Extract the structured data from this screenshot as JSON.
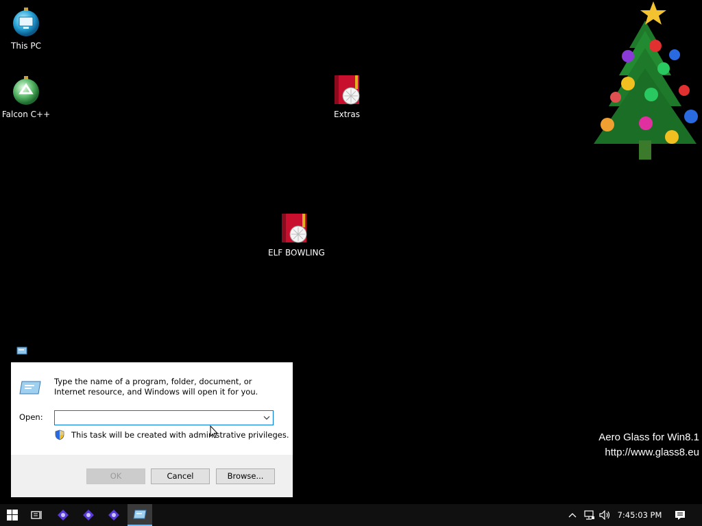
{
  "desktop": {
    "icons": [
      {
        "label": "This PC",
        "icon": "this-pc-icon"
      },
      {
        "label": "Falcon C++",
        "icon": "falcon-cpp-icon"
      },
      {
        "label": "Extras",
        "icon": "game-box-icon"
      },
      {
        "label": "ELF BOWLING",
        "icon": "game-box-icon"
      }
    ],
    "watermark": {
      "line1": "Aero Glass for Win8.1",
      "line2": "http://www.glass8.eu"
    }
  },
  "run_dialog": {
    "description": "Type the name of a program, folder, document, or Internet resource, and Windows will open it for you.",
    "open_label": "Open:",
    "open_value": "",
    "admin_note": "This task will be created with administrative privileges.",
    "buttons": {
      "ok": "OK",
      "cancel": "Cancel",
      "browse": "Browse..."
    }
  },
  "taskbar": {
    "clock": "7:45:03 PM",
    "pinned": [
      "start-icon",
      "task-view-icon",
      "app-icon",
      "app-icon",
      "app-icon",
      "run-icon"
    ]
  },
  "colors": {
    "desktop_bg": "#000000",
    "dialog_bg": "#ffffff",
    "dialog_footer": "#f0f0f0",
    "focus_border": "#0078d7",
    "taskbar_bg": "#101010"
  }
}
